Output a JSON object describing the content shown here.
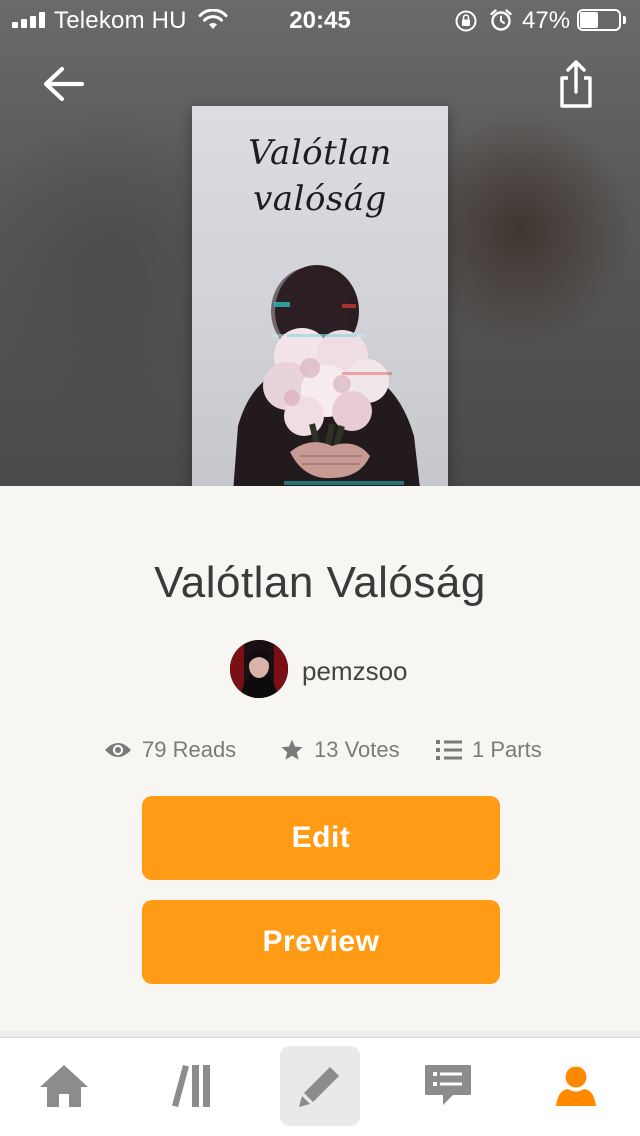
{
  "status_bar": {
    "carrier": "Telekom HU",
    "time": "20:45",
    "battery_percent": "47%",
    "battery_level": 0.47,
    "signal_bars": 4
  },
  "header": {
    "back_icon": "arrow-left-icon",
    "share_icon": "share-icon"
  },
  "cover": {
    "title_line1": "Valótlan",
    "title_line2": "valóság"
  },
  "story": {
    "title": "Valótlan Valóság",
    "author": "pemzsoo"
  },
  "stats": {
    "reads": "79 Reads",
    "votes": "13 Votes",
    "parts": "1 Parts"
  },
  "actions": {
    "edit_label": "Edit",
    "preview_label": "Preview"
  },
  "tab_bar": {
    "active": "write",
    "tabs": [
      {
        "id": "home",
        "icon": "home-icon"
      },
      {
        "id": "library",
        "icon": "library-icon"
      },
      {
        "id": "write",
        "icon": "pencil-icon"
      },
      {
        "id": "messages",
        "icon": "chat-icon"
      },
      {
        "id": "profile",
        "icon": "person-icon"
      }
    ]
  },
  "colors": {
    "accent": "#ff9b14",
    "background": "#f7f6f2",
    "icon_gray": "#8c8c8c"
  }
}
